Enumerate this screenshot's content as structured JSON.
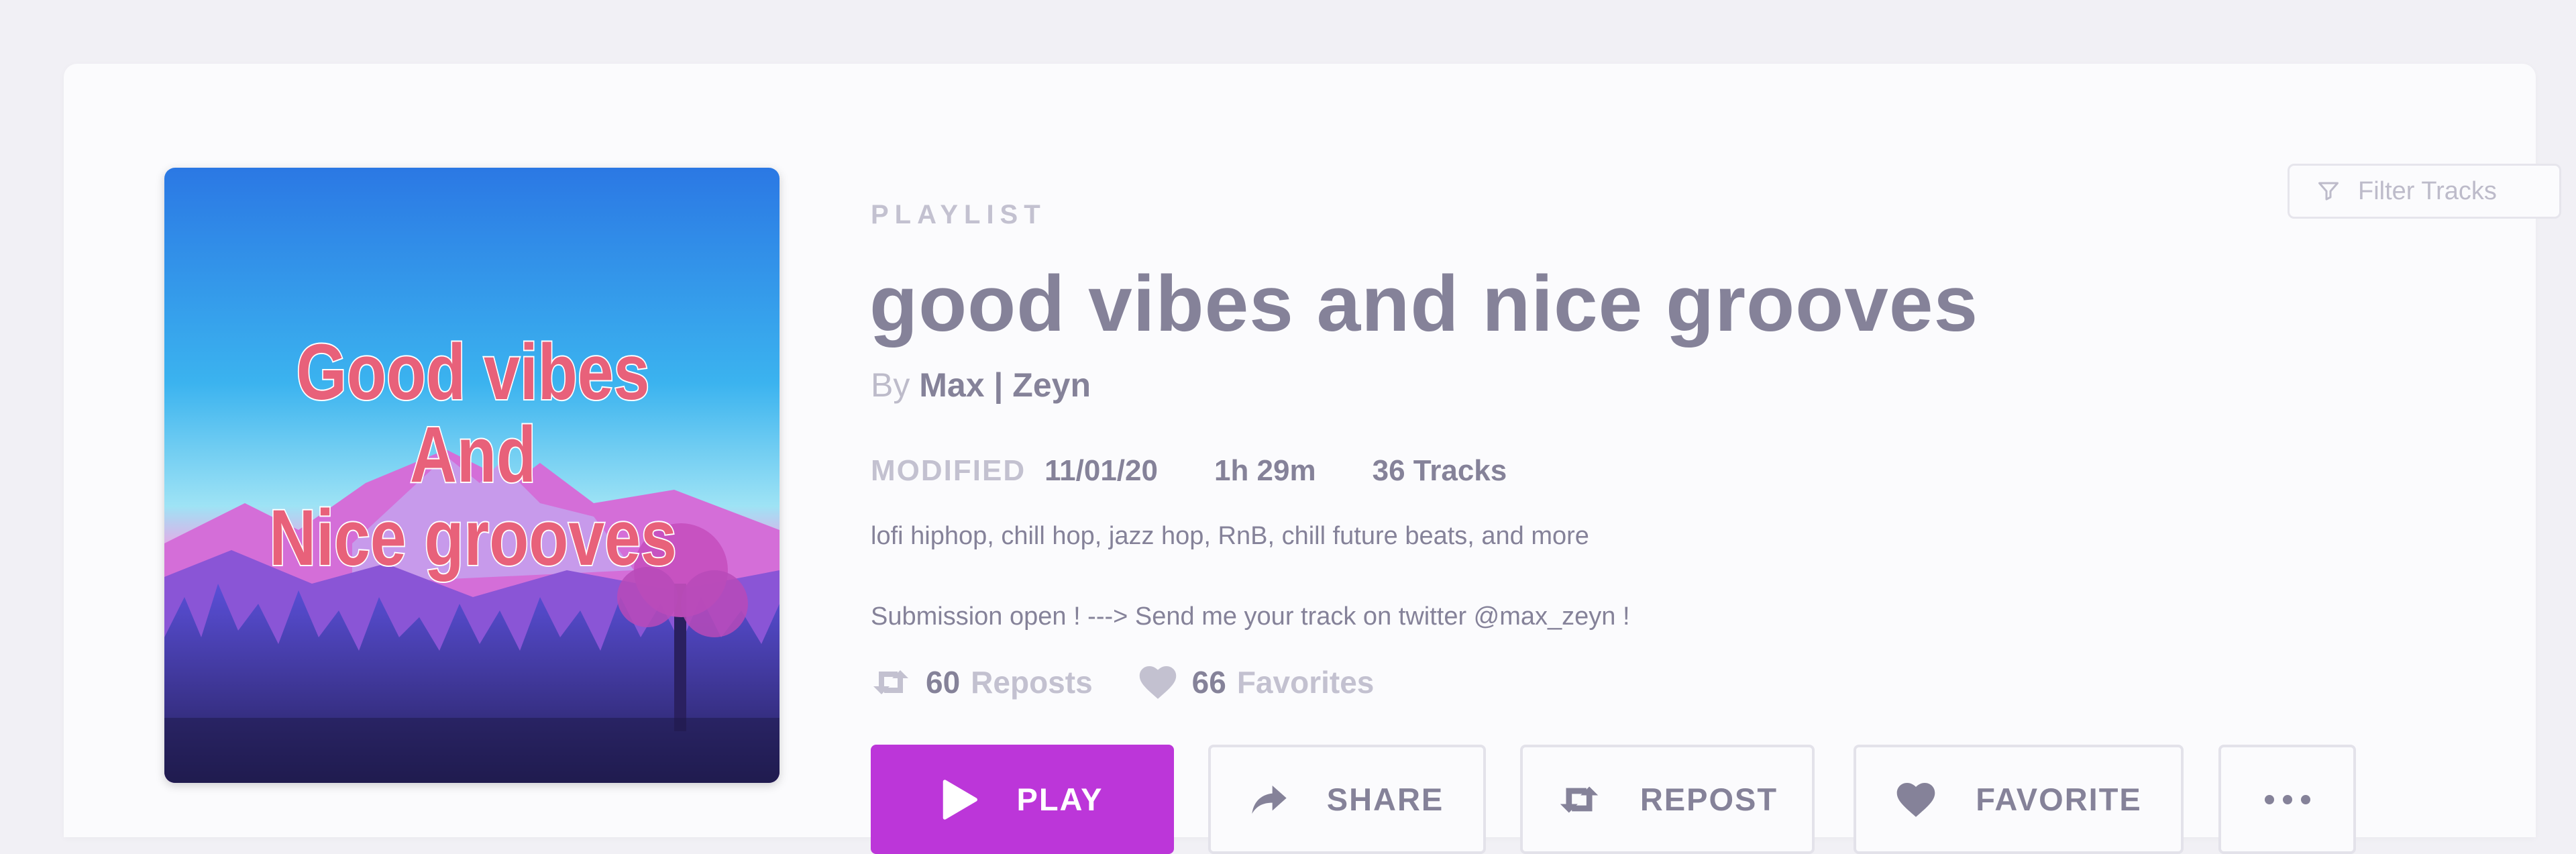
{
  "playlist": {
    "label": "PLAYLIST",
    "title": "good vibes and nice grooves",
    "by_prefix": "By",
    "author": "Max | Zeyn",
    "modified_label": "MODIFIED",
    "modified_date": "11/01/20",
    "duration": "1h 29m",
    "track_count": "36 Tracks",
    "description_line1": "lofi hiphop, chill hop, jazz hop, RnB, chill future beats, and more",
    "description_line2": "Submission open ! ---> Send me your track on twitter @max_zeyn !",
    "reposts_count": "60",
    "reposts_label": "Reposts",
    "favorites_count": "66",
    "favorites_label": "Favorites"
  },
  "artwork": {
    "text_line1": "Good vibes",
    "text_line2": "And",
    "text_line3": "Nice grooves"
  },
  "filter": {
    "placeholder": "Filter Tracks"
  },
  "actions": {
    "play_label": "PLAY",
    "share_label": "SHARE",
    "repost_label": "REPOST",
    "favorite_label": "FAVORITE"
  },
  "colors": {
    "accent": "#bc36d9",
    "text_primary": "#858299",
    "text_muted": "#c3c1d0",
    "background": "#f1f0f5",
    "card": "#fbfbfd"
  },
  "icons": {
    "filter": "funnel-icon",
    "repost": "repost-icon",
    "favorite": "heart-icon",
    "play": "play-icon",
    "share": "share-arrow-icon",
    "more": "more-dots-icon"
  }
}
